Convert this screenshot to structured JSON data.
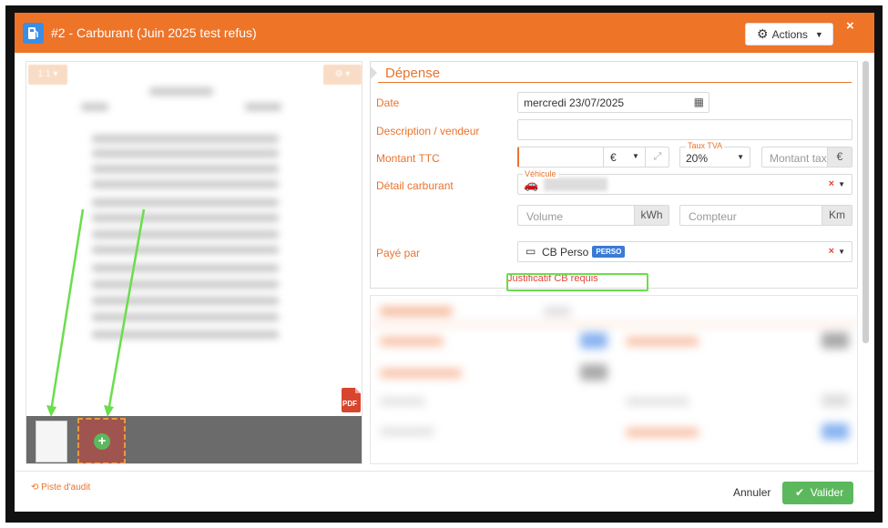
{
  "header": {
    "title": "#2 -  Carburant (Juin 2025 test refus)",
    "actions_label": "Actions",
    "close_label": "×"
  },
  "viewer": {
    "zoom_label": "1:1",
    "pdf_label": "PDF"
  },
  "form": {
    "section_title": "Dépense",
    "date_label": "Date",
    "date_value": "mercredi 23/07/2025",
    "description_label": "Description / vendeur",
    "amount_label": "Montant TTC",
    "currency_value": "€",
    "tva_float_label": "Taux TVA",
    "tva_value": "20%",
    "tax_placeholder": "Montant taxe",
    "tax_currency": "€",
    "fuel_label": "Détail carburant",
    "vehicle_float_label": "Véhicule",
    "volume_placeholder": "Volume",
    "volume_unit": "kWh",
    "counter_placeholder": "Compteur",
    "counter_unit": "Km",
    "paid_by_label": "Payé par",
    "paid_by_value": "CB Perso",
    "paid_by_badge": "PERSO",
    "warning": "Justificatif CB requis"
  },
  "footer": {
    "audit_label": "Piste d'audit",
    "cancel_label": "Annuler",
    "validate_label": "Valider"
  },
  "colors": {
    "brand": "#ee7428",
    "validate": "#5cb85c",
    "annotation": "#6ade4c"
  }
}
